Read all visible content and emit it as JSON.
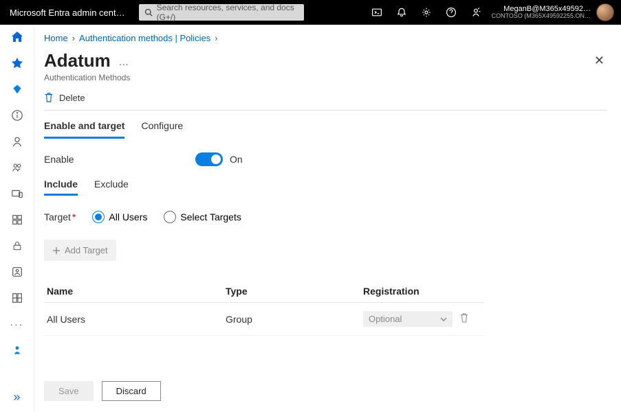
{
  "app": {
    "brand": "Microsoft Entra admin cent…"
  },
  "search": {
    "placeholder": "Search resources, services, and docs (G+/)"
  },
  "user": {
    "line1": "MeganB@M365x49592…",
    "line2": "CONTOSO (M365X49592255.ON…"
  },
  "breadcrumb": {
    "home": "Home",
    "path": "Authentication methods | Policies"
  },
  "page": {
    "title": "Adatum",
    "subtitle": "Authentication Methods"
  },
  "toolbar": {
    "delete": "Delete"
  },
  "tabs1": {
    "enable": "Enable and target",
    "configure": "Configure"
  },
  "enable": {
    "label": "Enable",
    "state": "On"
  },
  "tabs2": {
    "include": "Include",
    "exclude": "Exclude"
  },
  "target": {
    "label": "Target",
    "opt1": "All Users",
    "opt2": "Select Targets"
  },
  "addTarget": "Add Target",
  "table": {
    "headers": {
      "name": "Name",
      "type": "Type",
      "registration": "Registration"
    },
    "rows": [
      {
        "name": "All Users",
        "type": "Group",
        "registration": "Optional"
      }
    ]
  },
  "footer": {
    "save": "Save",
    "discard": "Discard"
  }
}
